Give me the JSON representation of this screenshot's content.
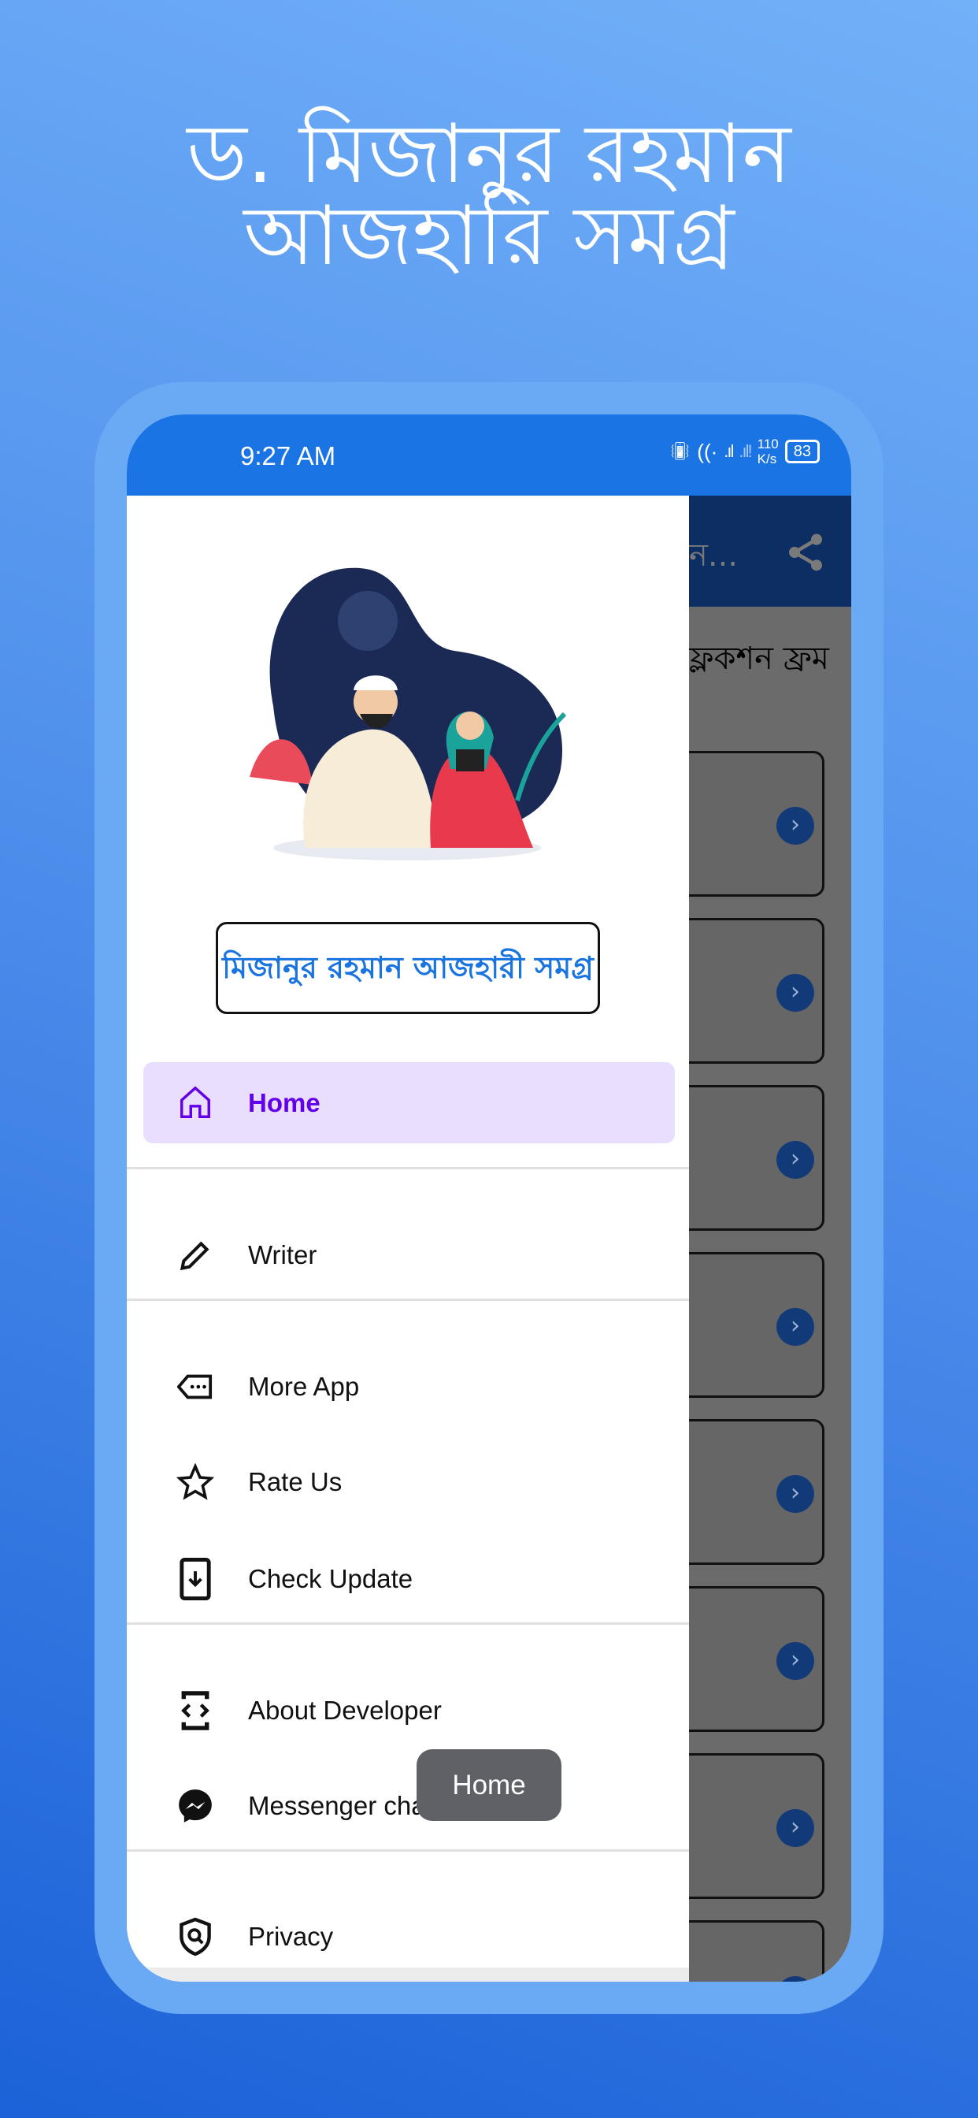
{
  "promo": {
    "title_line1": "ড. মিজানুর রহমান",
    "title_line2": "আজহারি সমগ্র"
  },
  "status_bar": {
    "time": "9:27 AM",
    "net_speed_value": "110",
    "net_speed_unit": "K/s",
    "battery": "83"
  },
  "app_bar": {
    "title_fragment": "ন...",
    "share_icon": "share-icon"
  },
  "background_screen": {
    "subheading_fragment": "ফ্লকশন ফ্রম",
    "card_count": 8
  },
  "drawer": {
    "app_name": "মিজানুর রহমান আজহারী সমগ্র",
    "items": [
      {
        "label": "Home",
        "icon": "home-icon",
        "selected": true
      },
      {
        "label": "Writer",
        "icon": "pencil-icon"
      },
      {
        "label": "More App",
        "icon": "tag-more-icon"
      },
      {
        "label": "Rate Us",
        "icon": "star-icon"
      },
      {
        "label": "Check Update",
        "icon": "phone-download-icon"
      },
      {
        "label": "About Developer",
        "icon": "developer-mode-icon"
      },
      {
        "label": "Messenger chats",
        "icon": "messenger-icon"
      },
      {
        "label": "Privacy",
        "icon": "shield-search-icon"
      }
    ]
  },
  "toast": {
    "text": "Home"
  },
  "colors": {
    "accent": "#6200ea",
    "selected_bg": "#e9defd",
    "status_bar": "#1b74e4",
    "app_bar": "#0d2e62",
    "app_name": "#1a74e0"
  }
}
